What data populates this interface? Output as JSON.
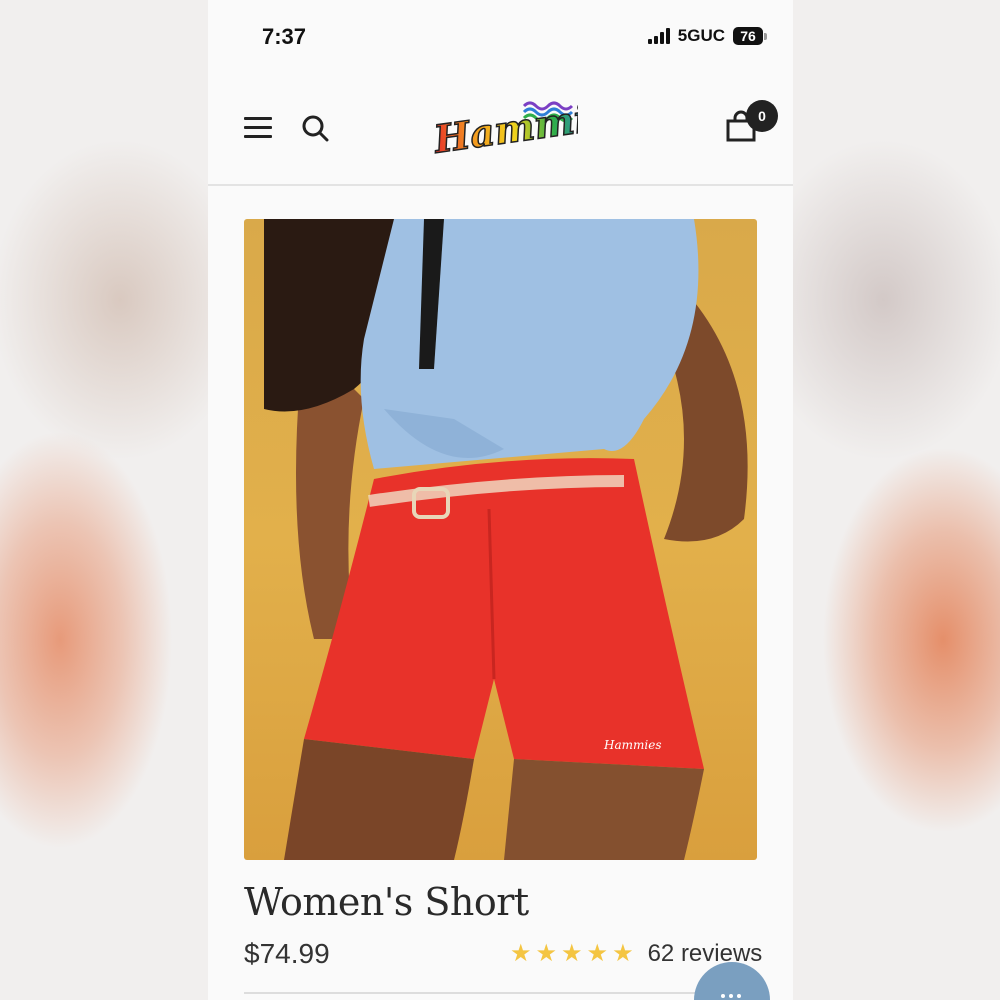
{
  "status_bar": {
    "time": "7:37",
    "network": "5GUC",
    "battery": "76"
  },
  "header": {
    "logo_text": "Hammies",
    "cart_count": "0",
    "icons": [
      "menu-icon",
      "search-icon",
      "shopping-bag-icon"
    ]
  },
  "product": {
    "title": "Women's Short",
    "price": "$74.99",
    "rating": 5,
    "reviews": "62 reviews",
    "colors": {
      "shorts": "#e8322a",
      "shirt": "#9fc0e3",
      "backdrop": "#dcaa48",
      "star": "#f4c542"
    }
  },
  "chat": {
    "icon": "chat-icon"
  }
}
